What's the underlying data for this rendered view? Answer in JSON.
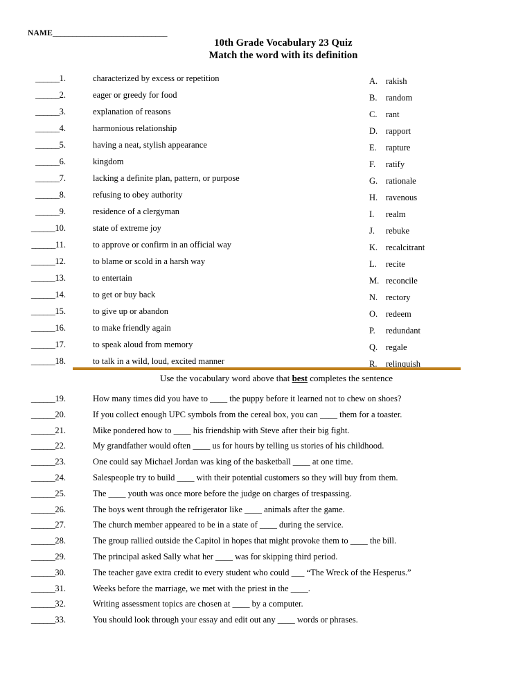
{
  "header": {
    "name_label": "NAME",
    "name_rule": "_____________________________",
    "title": "10th Grade Vocabulary 23 Quiz",
    "subtitle": "Match the word with its definition"
  },
  "divider": {
    "color": "#BF7F1B"
  },
  "section2": {
    "heading_before": "Use the vocabulary word above that ",
    "heading_bold": "best",
    "heading_after": " completes the sentence"
  },
  "matching": {
    "blank": "______",
    "definitions": [
      {
        "number": "1.",
        "text": "characterized by excess or repetition"
      },
      {
        "number": "2.",
        "text": "eager or greedy for food"
      },
      {
        "number": "3.",
        "text": "explanation of reasons"
      },
      {
        "number": "4.",
        "text": "harmonious relationship"
      },
      {
        "number": "5.",
        "text": "having a neat, stylish appearance"
      },
      {
        "number": "6.",
        "text": "kingdom"
      },
      {
        "number": "7.",
        "text": "lacking a definite plan, pattern, or purpose"
      },
      {
        "number": "8.",
        "text": "refusing to obey authority"
      },
      {
        "number": "9.",
        "text": "residence of a clergyman"
      },
      {
        "number": "10.",
        "text": "state of extreme joy"
      },
      {
        "number": "11.",
        "text": "to approve or confirm in an official way"
      },
      {
        "number": "12.",
        "text": "to blame or scold in a harsh way"
      },
      {
        "number": "13.",
        "text": "to entertain"
      },
      {
        "number": "14.",
        "text": "to get or buy back"
      },
      {
        "number": "15.",
        "text": "to give up or abandon"
      },
      {
        "number": "16.",
        "text": "to make friendly again"
      },
      {
        "number": "17.",
        "text": "to speak aloud from memory"
      },
      {
        "number": "18.",
        "text": "to talk in a wild, loud, excited manner"
      }
    ],
    "word_bank": [
      {
        "letter": "A.",
        "word": "rakish"
      },
      {
        "letter": "B.",
        "word": "random"
      },
      {
        "letter": "C.",
        "word": "rant"
      },
      {
        "letter": "D.",
        "word": "rapport"
      },
      {
        "letter": "E.",
        "word": "rapture"
      },
      {
        "letter": "F.",
        "word": "ratify"
      },
      {
        "letter": "G.",
        "word": "rationale"
      },
      {
        "letter": "H.",
        "word": "ravenous"
      },
      {
        "letter": "I.",
        "word": "realm"
      },
      {
        "letter": "J.",
        "word": "rebuke"
      },
      {
        "letter": "K.",
        "word": "recalcitrant"
      },
      {
        "letter": "L.",
        "word": "recite"
      },
      {
        "letter": "M.",
        "word": "reconcile"
      },
      {
        "letter": "N.",
        "word": "rectory"
      },
      {
        "letter": "O.",
        "word": "redeem"
      },
      {
        "letter": "P.",
        "word": "redundant"
      },
      {
        "letter": "Q.",
        "word": "regale"
      },
      {
        "letter": "R.",
        "word": "relinquish"
      }
    ]
  },
  "fill_in": {
    "blank": "______",
    "items": [
      {
        "number": "19.",
        "text": "How many times did you have to ____ the puppy before it learned not to chew on shoes?"
      },
      {
        "number": "20.",
        "text": "If you collect enough UPC symbols from the cereal box, you can ____ them for a toaster."
      },
      {
        "number": "21.",
        "text": "Mike pondered how to ____ his friendship with Steve after their big fight."
      },
      {
        "number": "22.",
        "text": "My grandfather would often ____ us for hours by telling us stories of his childhood."
      },
      {
        "number": "23.",
        "text": "One could say Michael Jordan was king of the basketball ____ at one time."
      },
      {
        "number": "24.",
        "text": "Salespeople try to build ____ with their potential customers so they will buy from them."
      },
      {
        "number": "25.",
        "text": "The ____ youth was once more before the judge on charges of trespassing."
      },
      {
        "number": "26.",
        "text": "The boys went through the refrigerator like ____ animals after the game."
      },
      {
        "number": "27.",
        "text": "The church member appeared to be in a state of ____ during the service."
      },
      {
        "number": "28.",
        "text": "The group rallied outside the Capitol in hopes that might provoke them to ____ the bill."
      },
      {
        "number": "29.",
        "text": "The principal asked Sally what her ____ was for skipping third period."
      },
      {
        "number": "30.",
        "text": "The teacher gave extra credit to every student who could ___ “The Wreck of the Hesperus.”"
      },
      {
        "number": "31.",
        "text": "Weeks before the marriage, we met with the priest in the ____."
      },
      {
        "number": "32.",
        "text": "Writing assessment topics are chosen at ____ by a computer."
      },
      {
        "number": "33.",
        "text": "You should look through your essay and edit out any ____ words or phrases."
      }
    ]
  }
}
